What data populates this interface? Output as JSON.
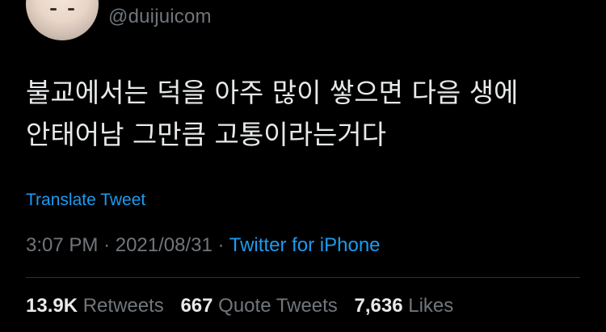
{
  "author": {
    "handle": "@duijuicom"
  },
  "tweet": {
    "lines": [
      "불교에서는 덕을 아주 많이 쌓으면 다음 생에",
      "안태어남 그만큼 고통이라는거다"
    ],
    "translate_label": "Translate Tweet",
    "time": "3:07 PM",
    "date": "2021/08/31",
    "separator": "·",
    "source": "Twitter for iPhone"
  },
  "stats": {
    "retweets": {
      "count": "13.9K",
      "label": "Retweets"
    },
    "quote_tweets": {
      "count": "667",
      "label": "Quote Tweets"
    },
    "likes": {
      "count": "7,636",
      "label": "Likes"
    }
  },
  "colors": {
    "background": "#000000",
    "text": "#e7e9ea",
    "secondary": "#71767b",
    "link": "#1d9bf0",
    "divider": "#2f3336"
  }
}
